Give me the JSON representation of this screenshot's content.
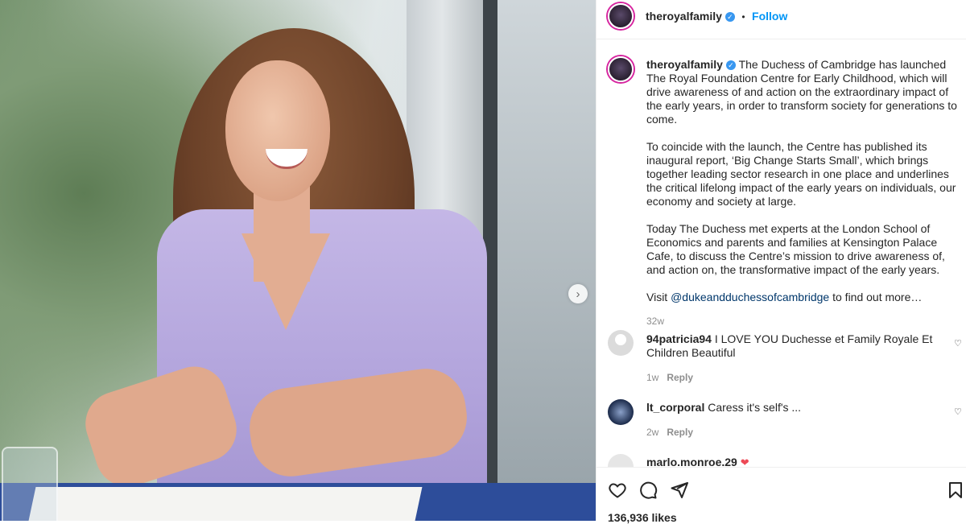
{
  "post": {
    "username": "theroyalfamily",
    "follow_label": "Follow",
    "separator": "•",
    "caption_username": "theroyalfamily",
    "caption_p1": "The Duchess of Cambridge has launched The Royal Foundation Centre for Early Childhood, which will drive awareness of and action on the extraordinary impact of the early years, in order to transform society for generations to come.",
    "caption_p2": "To coincide with the launch, the Centre has published its inaugural report, ‘Big Change Starts Small’, which brings together leading sector research in one place and underlines the critical lifelong impact of the early years on individuals, our economy and society at large.",
    "caption_p3": "Today The Duchess met experts at the London School of Economics and parents and families at Kensington Palace Cafe, to discuss the Centre’s mission to drive awareness of, and action on, the transformative impact of the early years.",
    "caption_p4_prefix": "Visit ",
    "caption_p4_link": "@dukeandduchessofcambridge",
    "caption_p4_suffix": " to find out more…",
    "caption_age": "32w",
    "likes": "136,936 likes"
  },
  "comments": [
    {
      "username": "94patricia94",
      "text": "I LOVE YOU Duchesse et Family Royale Et Children Beautiful",
      "age": "1w",
      "reply": "Reply"
    },
    {
      "username": "lt_corporal",
      "text": "Caress it's self's ...",
      "age": "2w",
      "reply": "Reply"
    },
    {
      "username": "marlo.monroe.29",
      "text": "",
      "emoji": "❤"
    }
  ],
  "colors": {
    "accent": "#0095f6",
    "verified": "#3897f0",
    "heart": "#ed4956"
  }
}
